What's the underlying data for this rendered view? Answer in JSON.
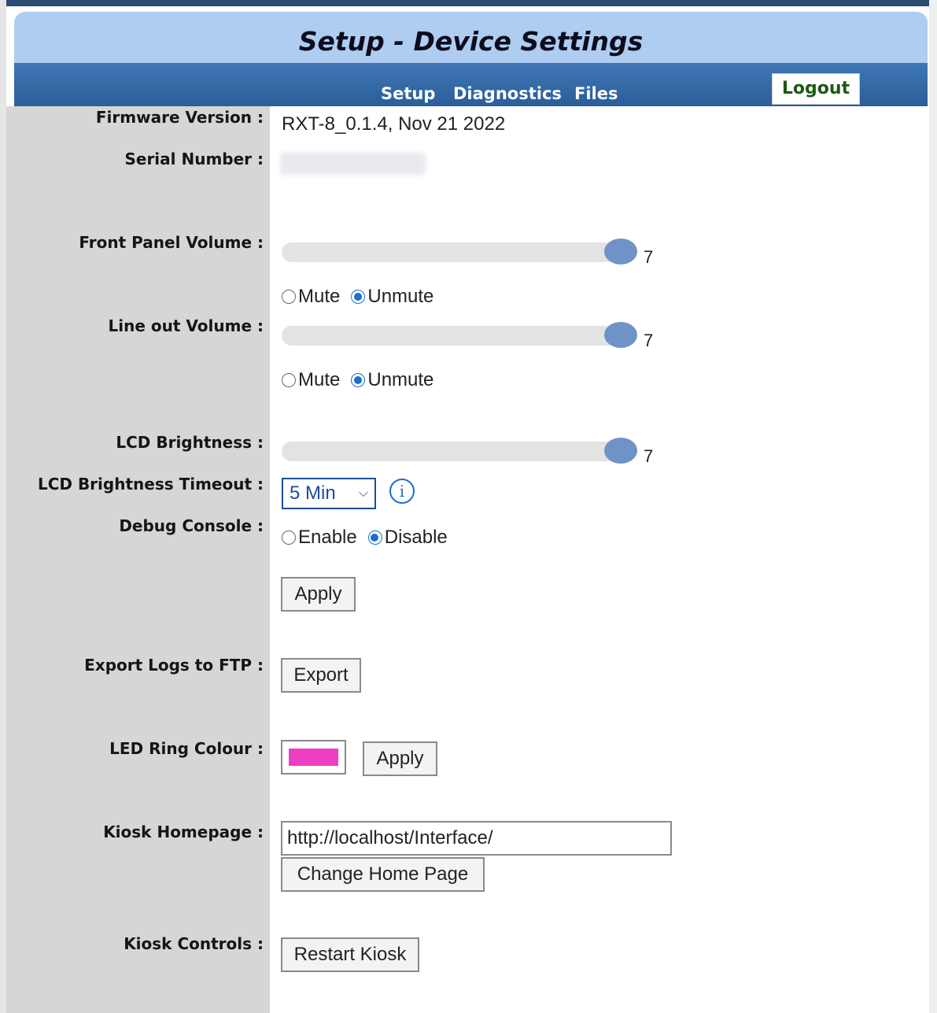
{
  "header": {
    "title": "Setup - Device Settings",
    "nav": [
      "Setup",
      "Diagnostics",
      "Files"
    ],
    "logout_label": "Logout"
  },
  "settings": {
    "firmware_label": "Firmware Version :",
    "firmware_value": "RXT-8_0.1.4, Nov 21 2022",
    "serial_label": "Serial Number :",
    "front_volume_label": "Front Panel Volume :",
    "front_volume_value": "7",
    "line_out_label": "Line out Volume :",
    "line_out_value": "7",
    "mute_label": "Mute",
    "unmute_label": "Unmute",
    "lcd_brightness_label": "LCD Brightness :",
    "lcd_brightness_value": "7",
    "lcd_timeout_label": "LCD Brightness Timeout :",
    "lcd_timeout_value": "5 Min",
    "debug_label": "Debug Console :",
    "enable_label": "Enable",
    "disable_label": "Disable",
    "apply_label": "Apply",
    "export_logs_label": "Export Logs to FTP :",
    "export_label": "Export",
    "led_label": "LED Ring Colour :",
    "led_color": "#ee3fc3",
    "kiosk_homepage_label": "Kiosk Homepage :",
    "kiosk_homepage_value": "http://localhost/Interface/",
    "change_home_label": "Change Home Page",
    "kiosk_controls_label": "Kiosk Controls :",
    "restart_kiosk_label": "Restart Kiosk"
  },
  "sliders": {
    "front_volume_fraction": 1.0,
    "line_out_fraction": 1.0,
    "lcd_brightness_fraction": 1.0
  },
  "colors": {
    "header_bg": "#aecdf0",
    "nav_bg": "#3570ad",
    "logout_text": "#1d5a12",
    "left_panel": "#d6d6d6",
    "slider_thumb": "#6f93c6",
    "radio_checked": "#1a6fd1"
  },
  "icons": {
    "info": "info-icon",
    "select_chevron": "chevron-down-icon"
  }
}
